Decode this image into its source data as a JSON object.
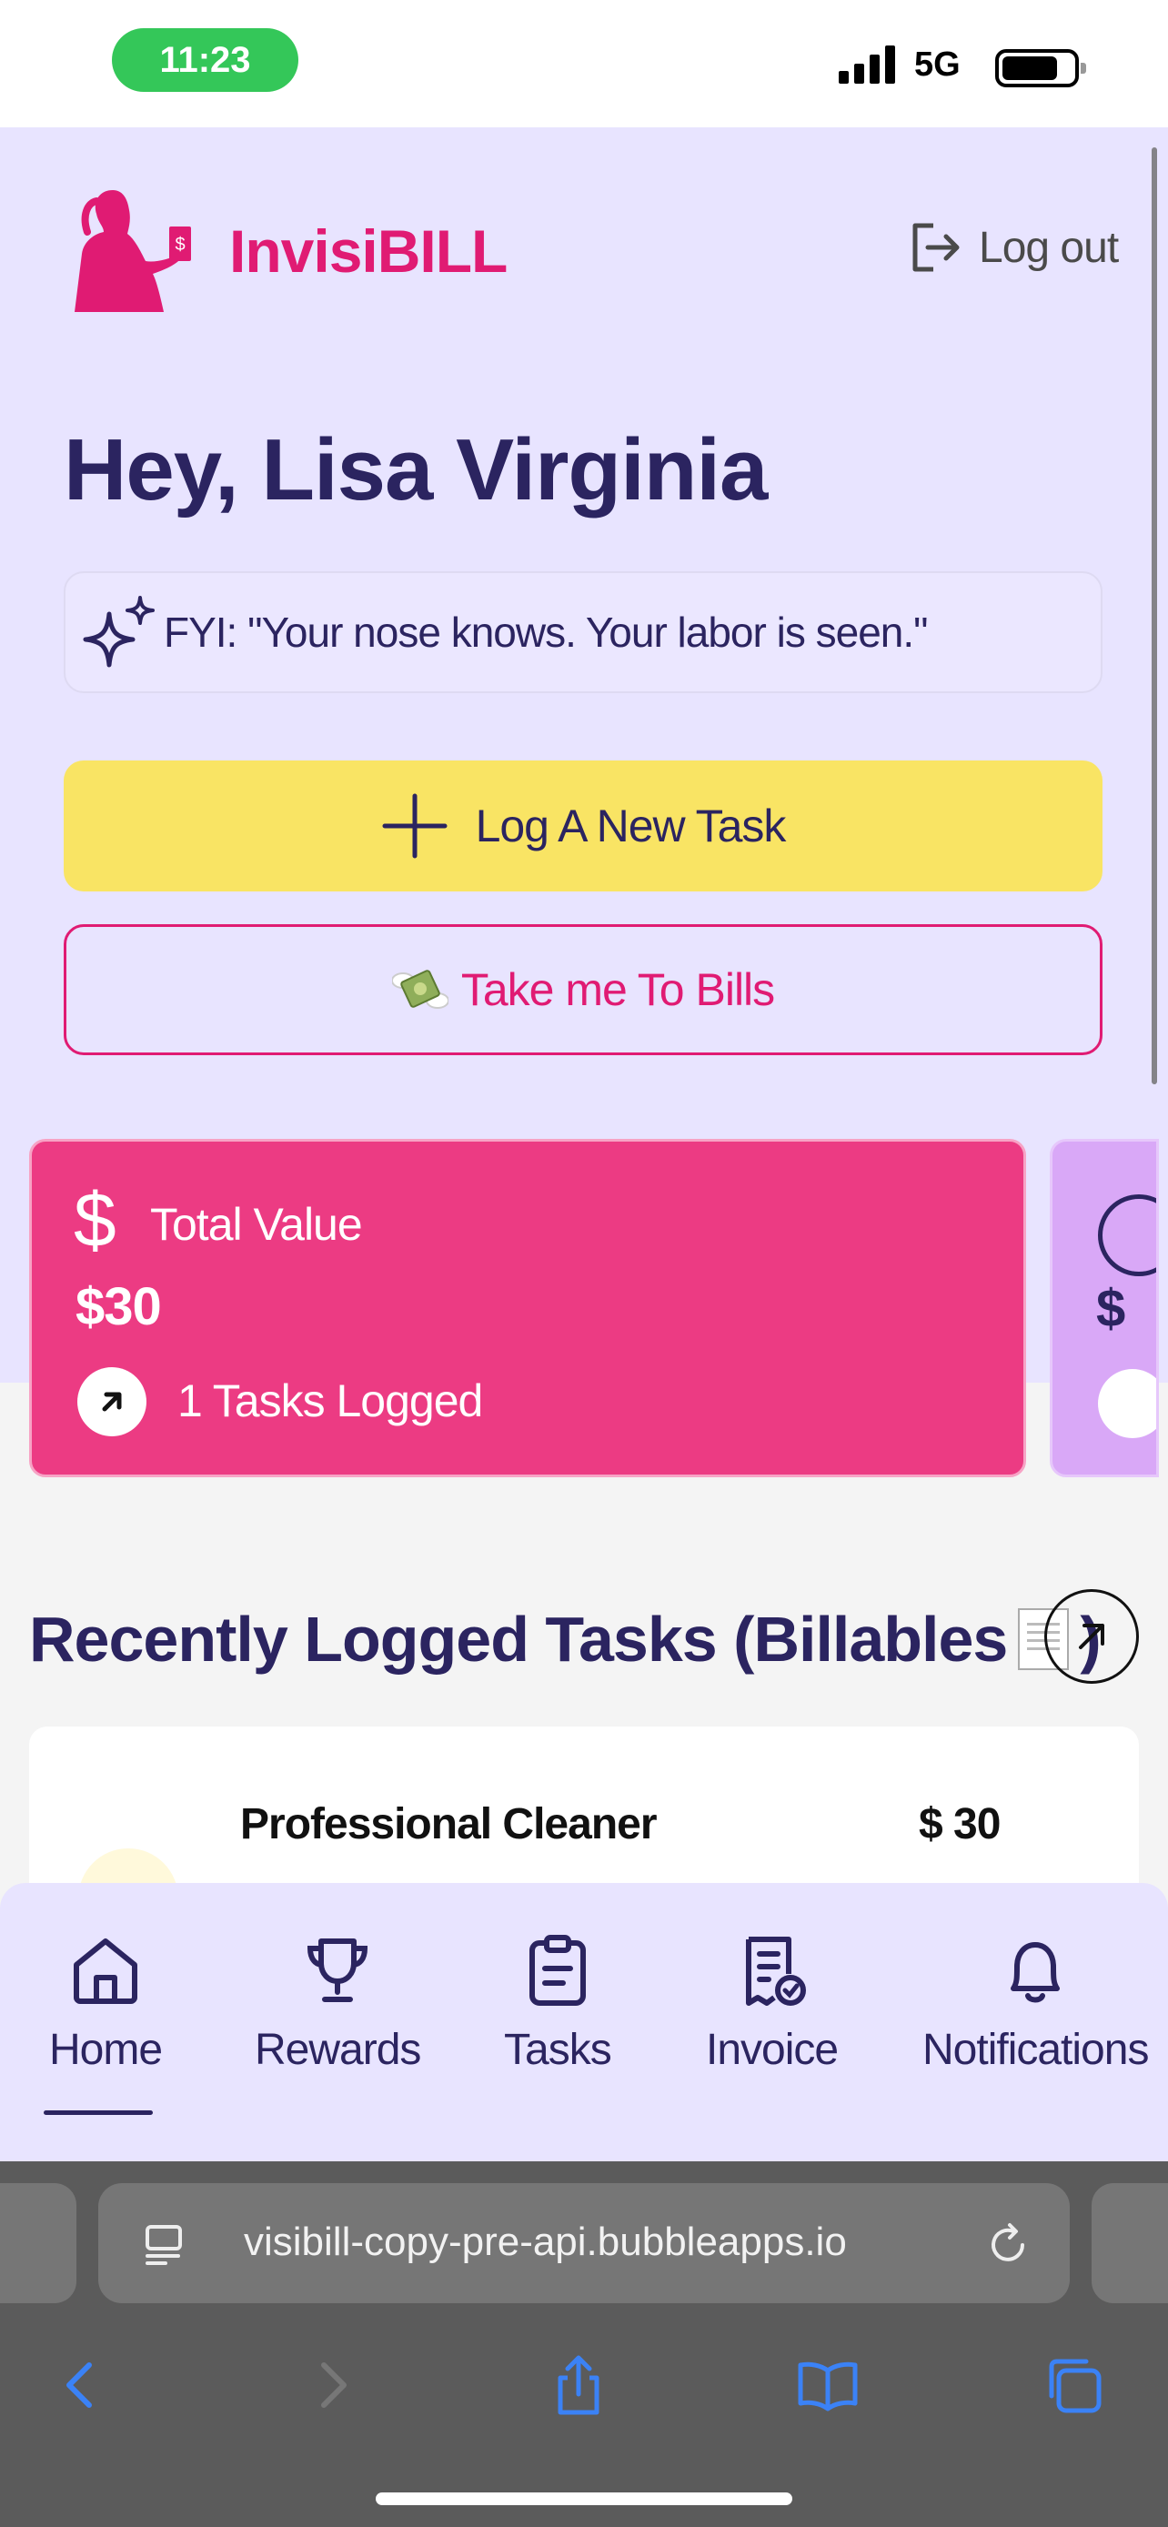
{
  "status_bar": {
    "time": "11:23",
    "network": "5G"
  },
  "header": {
    "brand": "InvisiBILL",
    "logout_label": "Log out"
  },
  "greeting": "Hey, Lisa Virginia",
  "fyi": {
    "text": "FYI: \"Your nose knows. Your labor is seen.\""
  },
  "actions": {
    "new_task_label": "Log A New Task",
    "bills_label": "Take me To Bills"
  },
  "stats_card": {
    "currency_symbol": "$",
    "label": "Total Value",
    "value": "$30",
    "tasks_logged": "1 Tasks Logged"
  },
  "peek_card": {
    "value_prefix": "$"
  },
  "recent": {
    "title": "Recently Logged Tasks (Billables",
    "title_suffix": ")",
    "tasks": [
      {
        "name": "Professional Cleaner",
        "price": "$ 30"
      }
    ]
  },
  "nav": {
    "items": [
      {
        "label": "Home",
        "icon": "home-icon",
        "active": true
      },
      {
        "label": "Rewards",
        "icon": "trophy-icon"
      },
      {
        "label": "Tasks",
        "icon": "clipboard-icon"
      },
      {
        "label": "Invoice",
        "icon": "invoice-icon"
      },
      {
        "label": "Notifications",
        "icon": "bell-icon"
      }
    ]
  },
  "browser": {
    "url": "visibill-copy-pre-api.bubbleapps.io"
  },
  "colors": {
    "brand": "#e01b73",
    "navy": "#2b2460",
    "yellow": "#f9e464",
    "card_pink": "#ec3b83",
    "lavender": "#e8e4ff"
  }
}
